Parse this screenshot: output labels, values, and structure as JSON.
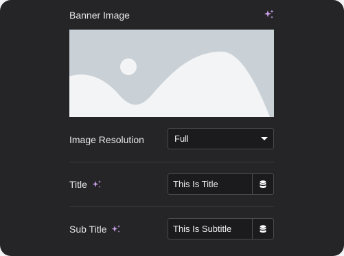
{
  "banner": {
    "label": "Banner Image",
    "ai_icon": "sparkle-icon"
  },
  "resolution": {
    "label": "Image Resolution",
    "value": "Full"
  },
  "title_field": {
    "label": "Title",
    "value": "This Is Title",
    "ai_icon": "sparkle-icon",
    "dynamic_icon": "database-icon"
  },
  "subtitle_field": {
    "label": "Sub Title",
    "value": "This Is Subtitle",
    "ai_icon": "sparkle-icon",
    "dynamic_icon": "database-icon"
  },
  "colors": {
    "panel_bg": "#252528",
    "ai_accent": "#c9a0e8",
    "placeholder_image": "#c9d1d7"
  }
}
